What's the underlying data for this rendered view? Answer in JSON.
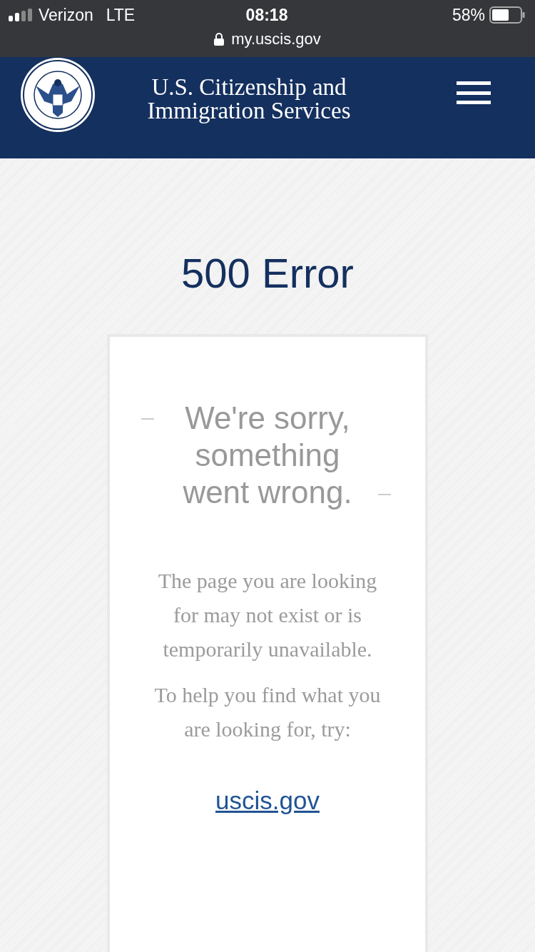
{
  "status_bar": {
    "carrier": "Verizon",
    "network": "LTE",
    "time": "08:18",
    "battery": "58%",
    "url": "my.uscis.gov"
  },
  "header": {
    "title": "U.S. Citizenship and Immigration Services"
  },
  "page": {
    "title": "500 Error",
    "card": {
      "heading": "We're sorry, something went wrong.",
      "paragraphs": [
        "The page you are looking for may not exist or is temporarily unavailable.",
        "To help you find what you are looking for, try:"
      ],
      "link": "uscis.gov"
    }
  }
}
